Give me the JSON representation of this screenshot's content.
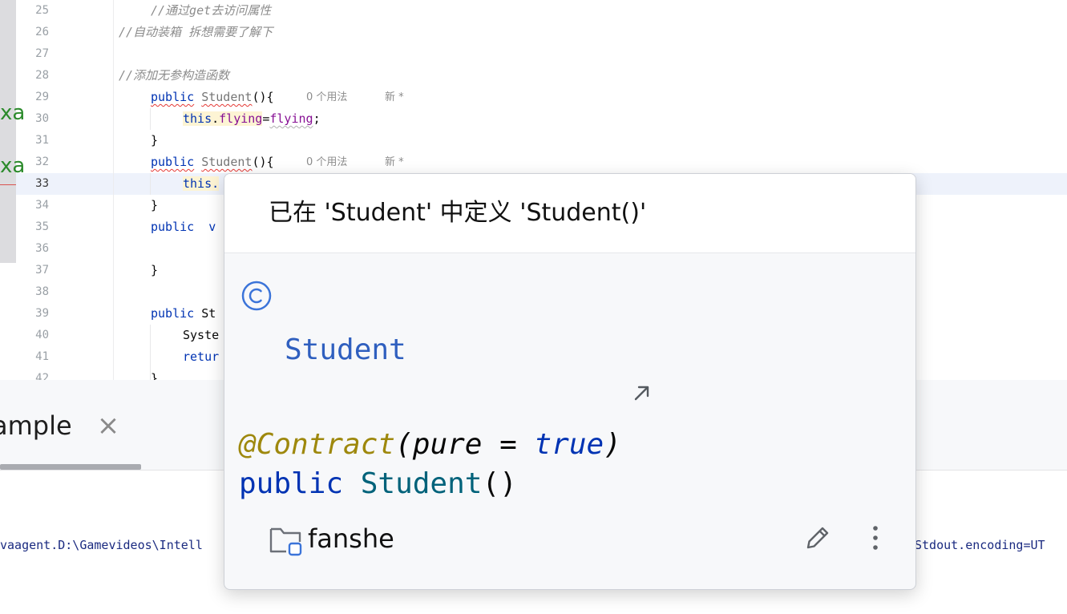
{
  "editor": {
    "lines": [
      {
        "n": "25",
        "code": "//通过get去访问属性"
      },
      {
        "n": "26",
        "code": "//自动装箱 拆想需要了解下"
      },
      {
        "n": "27",
        "code": ""
      },
      {
        "n": "28",
        "code": "//添加无参构造函数"
      },
      {
        "n": "29",
        "kw": "public",
        "ctor": "Student",
        "rest": "(){",
        "hint_usages": "0 个用法",
        "hint_new": "新 *"
      },
      {
        "n": "30",
        "this": "this",
        "dot": ".",
        "field": "flying",
        "eq": "=",
        "val": "flying",
        "semi": ";"
      },
      {
        "n": "31",
        "code": "}"
      },
      {
        "n": "32",
        "kw": "public",
        "ctor": "Student",
        "rest": "(){",
        "hint_usages": "0 个用法",
        "hint_new": "新 *"
      },
      {
        "n": "33",
        "this": "this."
      },
      {
        "n": "34",
        "code": "}"
      },
      {
        "n": "35",
        "kw": "public",
        "rest": "  v"
      },
      {
        "n": "36",
        "code": ""
      },
      {
        "n": "37",
        "code": "}"
      },
      {
        "n": "38",
        "code": ""
      },
      {
        "n": "39",
        "kw": "public",
        "rest": " St"
      },
      {
        "n": "40",
        "code": "Syste"
      },
      {
        "n": "41",
        "kw": "retur"
      },
      {
        "n": "42",
        "code": "}"
      }
    ],
    "left_marks": [
      "xa",
      "xa"
    ]
  },
  "bottom": {
    "tab_label": "ample",
    "tab_close_glyph": "×",
    "console_left": "vaagent.D:\\Gamevideos\\Intell",
    "console_right": "Stdout.encoding=UT"
  },
  "popup": {
    "title": "已在 'Student' 中定义 'Student()'",
    "class_name": "Student",
    "annotation": "@Contract",
    "ann_open": "(",
    "ann_param": "pure",
    "ann_eq": " = ",
    "ann_value": "true",
    "ann_close": ")",
    "sig_kw": "public",
    "sig_name": "Student",
    "sig_parens": "()",
    "package": "fanshe"
  },
  "colors": {
    "keyword": "#0033b3",
    "comment": "#8c8c8c",
    "field": "#871094",
    "annotation": "#9e880d",
    "class_link": "#2f5fbf",
    "error_underline": "#e53935"
  }
}
